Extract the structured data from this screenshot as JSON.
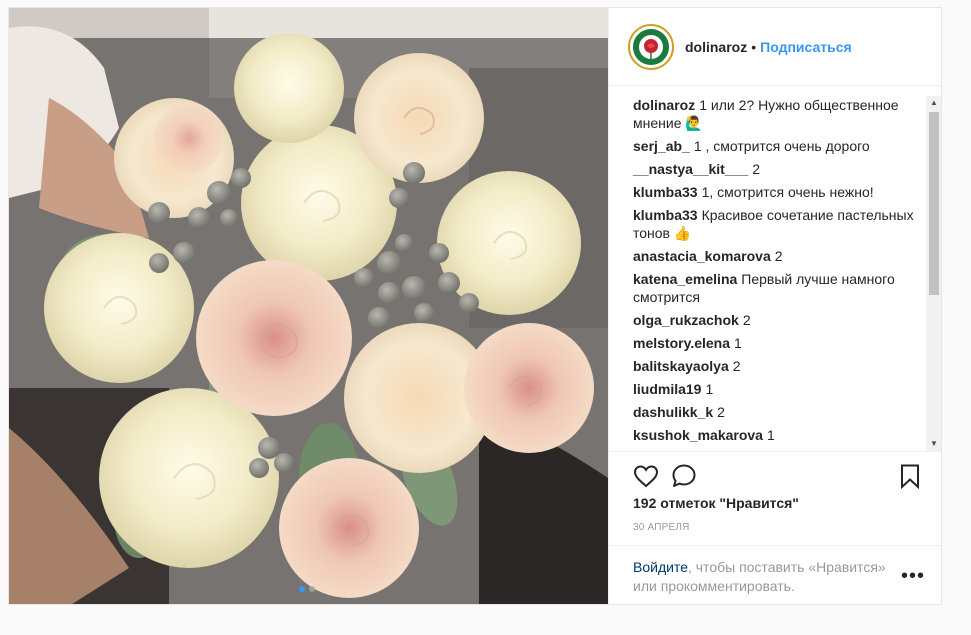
{
  "header": {
    "username": "dolinaroz",
    "separator": "•",
    "follow_label": "Подписаться",
    "avatar_text": "Долина роз"
  },
  "comments": [
    {
      "author": "dolinaroz",
      "text": "1 или 2? Нужно общественное мнение 🙋‍♂️"
    },
    {
      "author": "serj_ab_",
      "text": "1 , смотрится очень дорого"
    },
    {
      "author": "__nastya__kit___",
      "text": "2"
    },
    {
      "author": "klumba33",
      "text": "1, смотрится очень нежно!"
    },
    {
      "author": "klumba33",
      "text": "Красивое сочетание пастельных тонов 👍"
    },
    {
      "author": "anastacia_komarova",
      "text": "2"
    },
    {
      "author": "katena_emelina",
      "text": "Первый лучше намного смотрится"
    },
    {
      "author": "olga_rukzachok",
      "text": "2"
    },
    {
      "author": "melstory.elena",
      "text": "1"
    },
    {
      "author": "balitskayaolya",
      "text": "2"
    },
    {
      "author": "liudmila19",
      "text": "1"
    },
    {
      "author": "dashulikk_k",
      "text": "2"
    },
    {
      "author": "ksushok_makarova",
      "text": "1"
    }
  ],
  "likes_text": "192 отметок \"Нравится\"",
  "date_text": "30 апреля",
  "login": {
    "link": "Войдите",
    "rest": ", чтобы поставить «Нравится» или прокомментировать."
  },
  "more_label": "•••",
  "carousel": {
    "count": 2,
    "active_index": 0
  },
  "icons": {
    "like": "heart-icon",
    "comment": "comment-icon",
    "save": "bookmark-icon",
    "more": "more-options-icon"
  },
  "colors": {
    "accent": "#3897f0",
    "text": "#262626",
    "muted": "#999999",
    "link_dark": "#003569"
  }
}
